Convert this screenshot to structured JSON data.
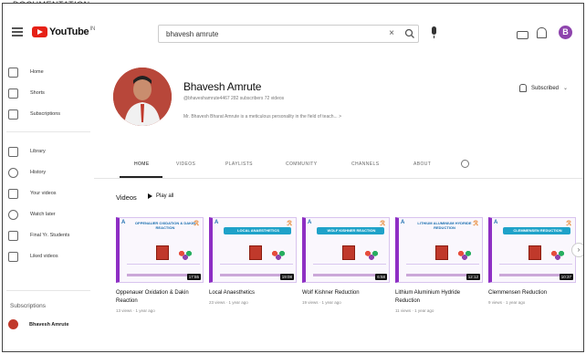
{
  "caption_top": "DOCUMENTATION",
  "header": {
    "logo_text": "YouTube",
    "logo_sup": "IN",
    "search_value": "bhavesh amrute"
  },
  "sidebar": {
    "items": [
      {
        "label": "Home",
        "icon": "home-icon"
      },
      {
        "label": "Shorts",
        "icon": "shorts-icon"
      },
      {
        "label": "Subscriptions",
        "icon": "subscriptions-icon"
      },
      {
        "label": "Library",
        "icon": "library-icon"
      },
      {
        "label": "History",
        "icon": "history-icon"
      },
      {
        "label": "Your videos",
        "icon": "your-videos-icon"
      },
      {
        "label": "Watch later",
        "icon": "watch-later-icon"
      },
      {
        "label": "Final Yr. Students",
        "icon": "playlist-icon"
      },
      {
        "label": "Liked videos",
        "icon": "like-icon"
      }
    ],
    "subscriptions_heading": "Subscriptions",
    "subscription": "Bhavesh Amrute"
  },
  "channel": {
    "name": "Bhavesh Amrute",
    "handle_meta": "@bhaveshamrute4467   282 subscribers   72 videos",
    "description": "Mr. Bhavesh Bharat Amrute is a meticulous personality in the field of teach...   >",
    "subscribe_label": "Subscribed"
  },
  "tabs": [
    "HOME",
    "VIDEOS",
    "PLAYLISTS",
    "COMMUNITY",
    "CHANNELS",
    "ABOUT"
  ],
  "active_tab": "HOME",
  "videos_section": {
    "title": "Videos",
    "play_all": "Play all"
  },
  "videos": [
    {
      "thumb_title": "OPPENAUER OXIDATION & DAKIN REACTION",
      "duration": "17:55",
      "title": "Oppenauer Oxidation & Dakin Reaction",
      "meta": "13 views · 1 year ago"
    },
    {
      "thumb_title": "LOCAL ANAESTHETICS",
      "duration": "19:08",
      "title": "Local Anaesthetics",
      "meta": "23 views · 1 year ago"
    },
    {
      "thumb_title": "WOLF KISHNER REACTION",
      "duration": "6:58",
      "title": "Wolf Kishner Reduction",
      "meta": "19 views · 1 year ago"
    },
    {
      "thumb_title": "LITHIUM ALUMINIUM HYDRIDE REDUCTION",
      "duration": "12:12",
      "title": "Lithium Aluminium Hydride Reduction",
      "meta": "11 views · 1 year ago"
    },
    {
      "thumb_title": "CLEMMENSEN REDUCTION",
      "duration": "10:37",
      "title": "Clemmensen Reduction",
      "meta": "9 views · 1 year ago"
    }
  ],
  "colors": {
    "youtube_red": "#e62117",
    "avatar_purple": "#8e44ad",
    "thumb_border": "#8e2fc4",
    "thumb_banner": "#1fa2c9"
  }
}
